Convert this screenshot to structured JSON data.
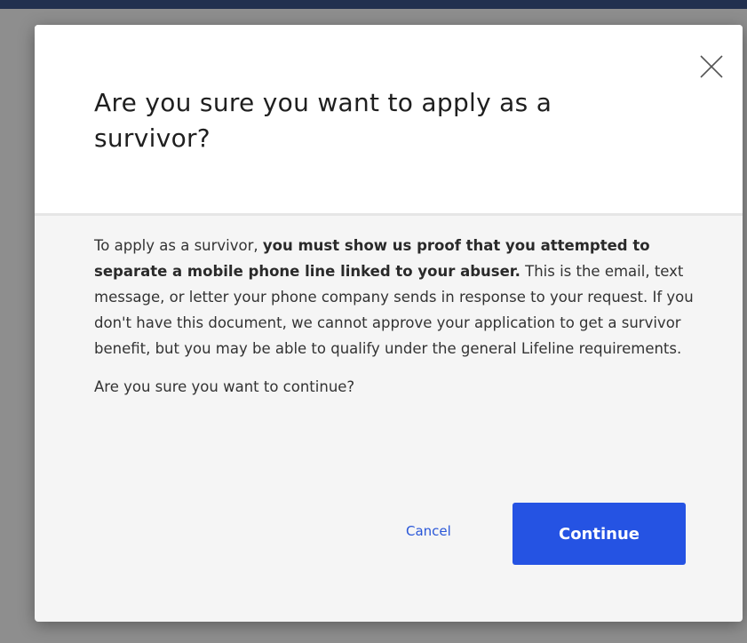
{
  "modal": {
    "title": "Are you sure you want to apply as a survivor?",
    "close_icon": "close-icon",
    "body": {
      "intro": "To apply as a survivor, ",
      "emphasis": "you must show us proof that you attempted to separate a mobile phone line linked to your abuser.",
      "rest": " This is the email, text message, or letter your phone company sends in response to your request. If you don't have this document, we cannot approve your application to get a survivor benefit, but you may be able to qualify under the general Lifeline requirements.",
      "question": "Are you sure you want to continue?"
    },
    "cancel_label": "Cancel",
    "continue_label": "Continue"
  },
  "colors": {
    "primary": "#2553e3",
    "link": "#2a57d8",
    "overlay": "#8e8e8e",
    "modal_body_bg": "#f5f5f5",
    "modal_header_bg": "#ffffff"
  }
}
